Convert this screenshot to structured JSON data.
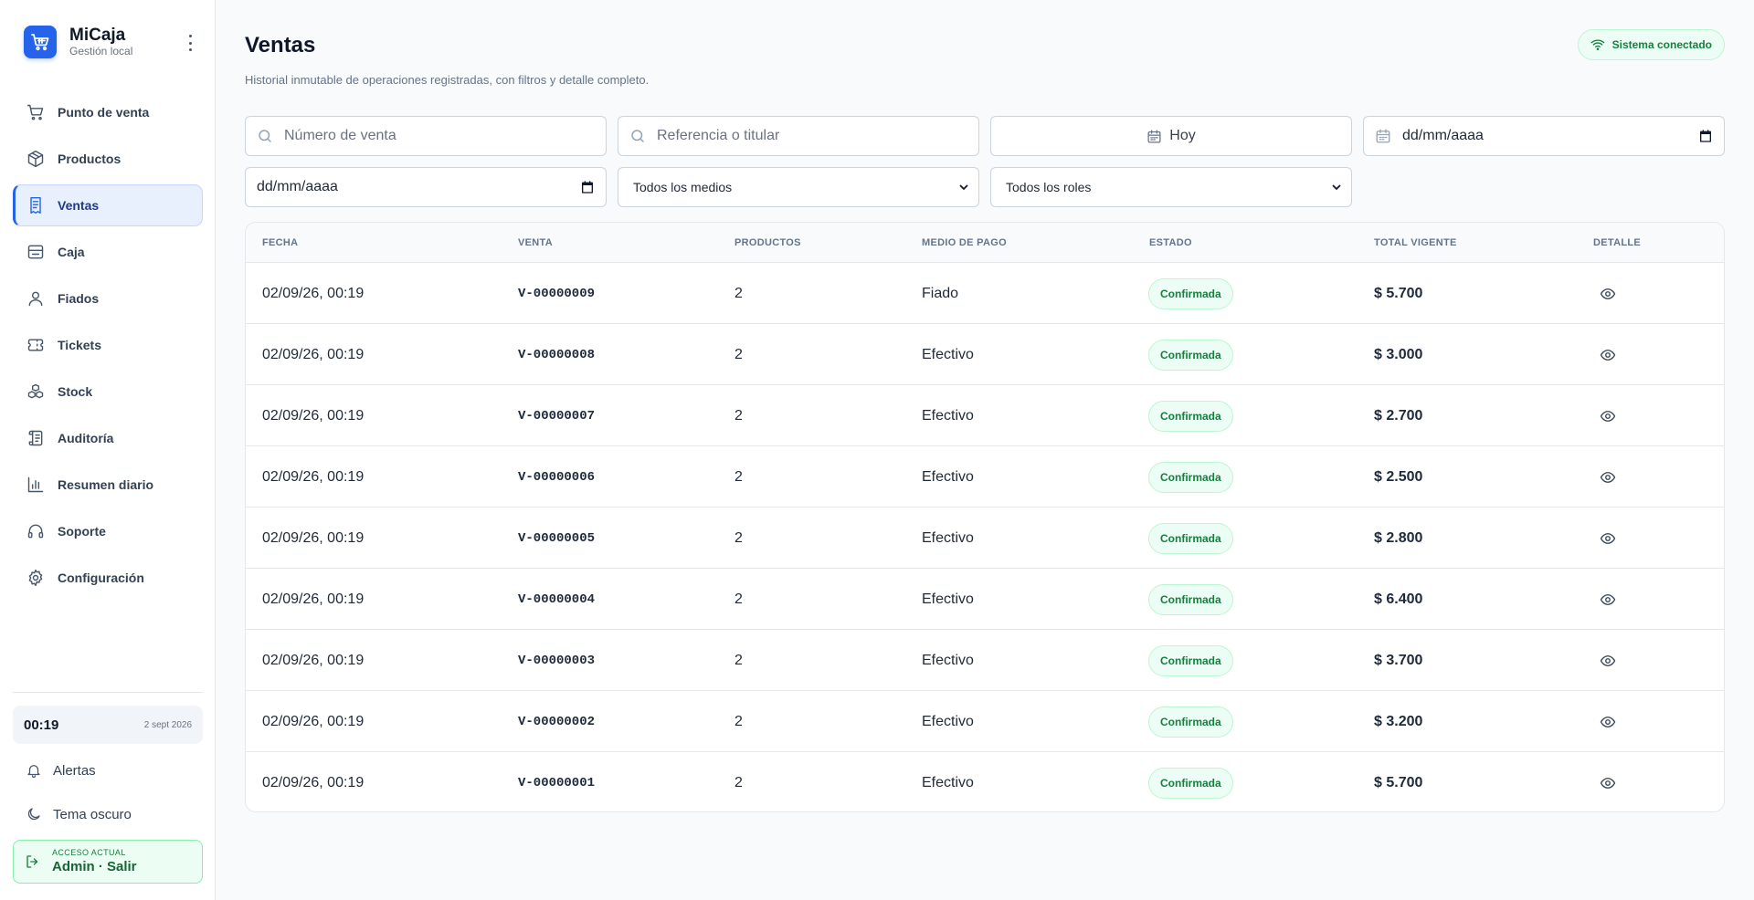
{
  "brand": {
    "name": "MiCaja",
    "subtitle": "Gestión local"
  },
  "nav": [
    {
      "label": "Punto de venta",
      "icon": "cart-icon"
    },
    {
      "label": "Productos",
      "icon": "box-icon"
    },
    {
      "label": "Ventas",
      "icon": "receipt-icon",
      "active": true
    },
    {
      "label": "Caja",
      "icon": "cash-drawer-icon"
    },
    {
      "label": "Fiados",
      "icon": "user-icon"
    },
    {
      "label": "Tickets",
      "icon": "ticket-icon"
    },
    {
      "label": "Stock",
      "icon": "boxes-icon"
    },
    {
      "label": "Auditoría",
      "icon": "scroll-icon"
    },
    {
      "label": "Resumen diario",
      "icon": "bar-chart-icon"
    },
    {
      "label": "Soporte",
      "icon": "headset-icon"
    },
    {
      "label": "Configuración",
      "icon": "gear-icon"
    }
  ],
  "clock": {
    "time": "00:19",
    "date": "2 sept 2026"
  },
  "side_actions": {
    "alerts": "Alertas",
    "theme": "Tema oscuro"
  },
  "access": {
    "label": "ACCESO ACTUAL",
    "user": "Admin · Salir"
  },
  "page": {
    "title": "Ventas",
    "subtitle": "Historial inmutable de operaciones registradas, con filtros y detalle completo.",
    "status": "Sistema conectado"
  },
  "filters": {
    "sale_number_placeholder": "Número de venta",
    "reference_placeholder": "Referencia o titular",
    "date_preset": "Hoy",
    "date_from": "dd/mm/aaaa",
    "date_to": "dd/mm/aaaa",
    "payment_method": "Todos los medios",
    "role": "Todos los roles"
  },
  "table": {
    "headers": {
      "date": "FECHA",
      "sale": "VENTA",
      "products": "PRODUCTOS",
      "payment": "MEDIO DE PAGO",
      "status": "ESTADO",
      "total": "TOTAL VIGENTE",
      "detail": "DETALLE"
    },
    "rows": [
      {
        "date": "02/09/26, 00:19",
        "sale": "V-00000009",
        "products": "2",
        "payment": "Fiado",
        "status": "Confirmada",
        "total": "$ 5.700"
      },
      {
        "date": "02/09/26, 00:19",
        "sale": "V-00000008",
        "products": "2",
        "payment": "Efectivo",
        "status": "Confirmada",
        "total": "$ 3.000"
      },
      {
        "date": "02/09/26, 00:19",
        "sale": "V-00000007",
        "products": "2",
        "payment": "Efectivo",
        "status": "Confirmada",
        "total": "$ 2.700"
      },
      {
        "date": "02/09/26, 00:19",
        "sale": "V-00000006",
        "products": "2",
        "payment": "Efectivo",
        "status": "Confirmada",
        "total": "$ 2.500"
      },
      {
        "date": "02/09/26, 00:19",
        "sale": "V-00000005",
        "products": "2",
        "payment": "Efectivo",
        "status": "Confirmada",
        "total": "$ 2.800"
      },
      {
        "date": "02/09/26, 00:19",
        "sale": "V-00000004",
        "products": "2",
        "payment": "Efectivo",
        "status": "Confirmada",
        "total": "$ 6.400"
      },
      {
        "date": "02/09/26, 00:19",
        "sale": "V-00000003",
        "products": "2",
        "payment": "Efectivo",
        "status": "Confirmada",
        "total": "$ 3.700"
      },
      {
        "date": "02/09/26, 00:19",
        "sale": "V-00000002",
        "products": "2",
        "payment": "Efectivo",
        "status": "Confirmada",
        "total": "$ 3.200"
      },
      {
        "date": "02/09/26, 00:19",
        "sale": "V-00000001",
        "products": "2",
        "payment": "Efectivo",
        "status": "Confirmada",
        "total": "$ 5.700"
      }
    ]
  },
  "colors": {
    "accent": "#2563eb",
    "success": "#15803d",
    "success_bg": "#ecfdf5"
  }
}
